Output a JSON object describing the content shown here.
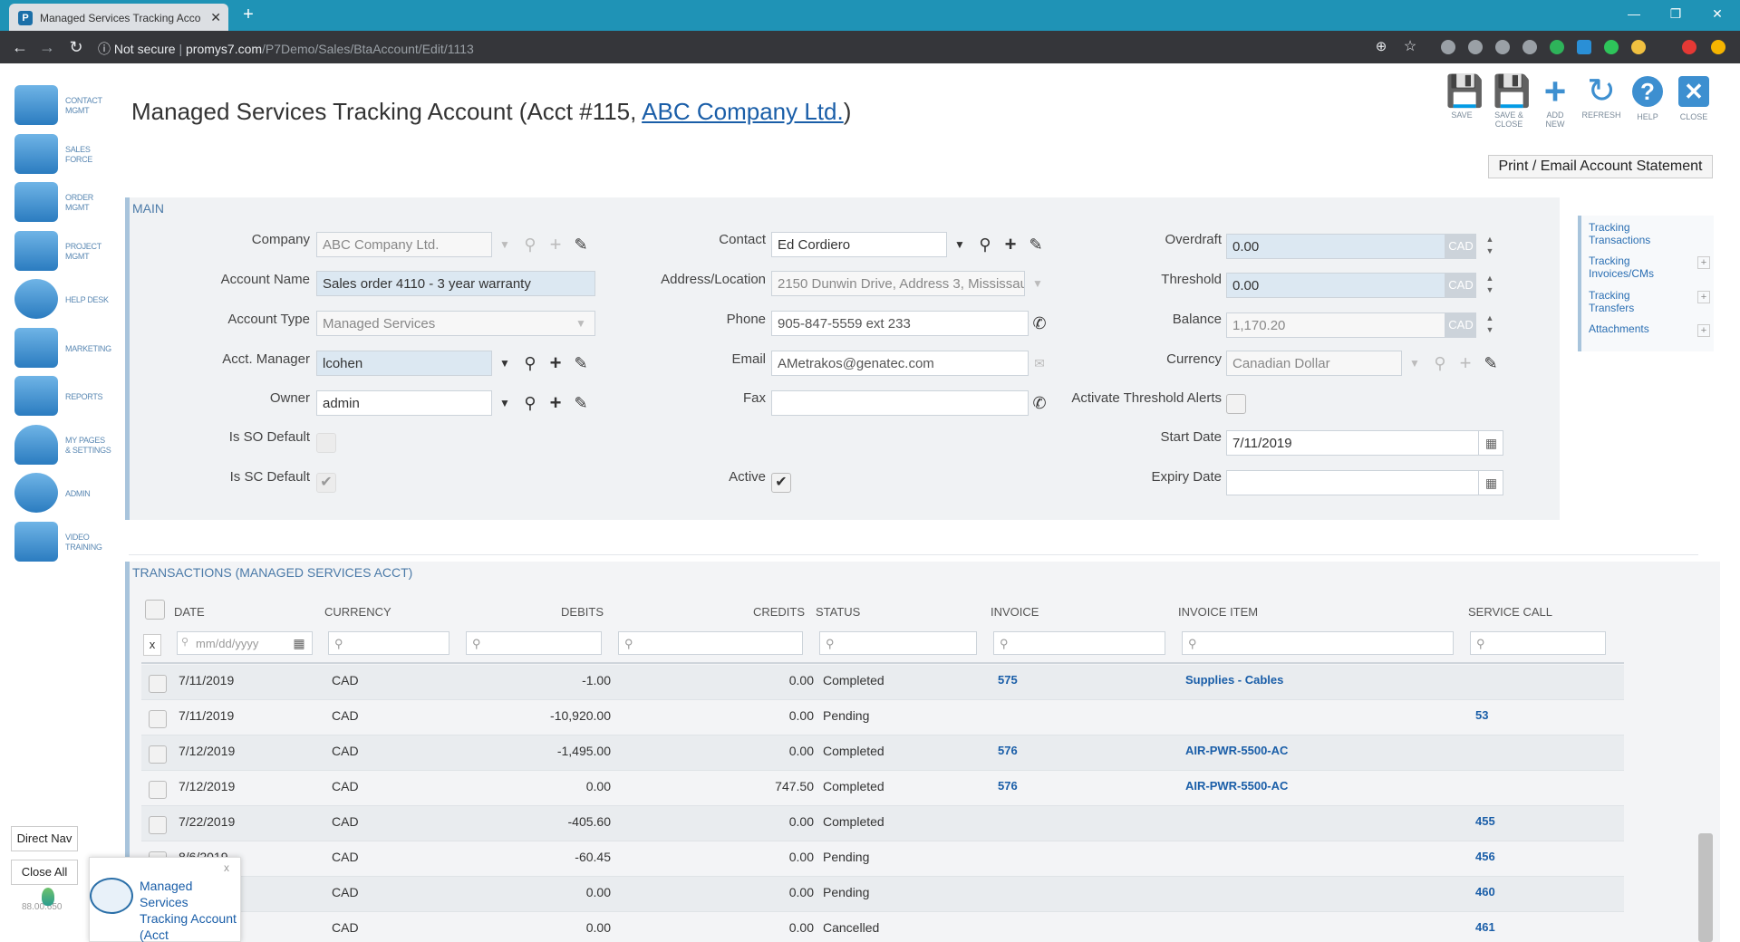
{
  "browser": {
    "tab_title": "Managed Services Tracking Acco",
    "new_tab": "+",
    "url_security": "Not secure",
    "url_host": "promys7.com",
    "url_path": "/P7Demo/Sales/BtaAccount/Edit/1113"
  },
  "leftnav": [
    {
      "line1": "CONTACT",
      "line2": "MGMT"
    },
    {
      "line1": "SALES",
      "line2": "FORCE"
    },
    {
      "line1": "ORDER",
      "line2": "MGMT"
    },
    {
      "line1": "PROJECT",
      "line2": "MGMT"
    },
    {
      "line1": "HELP DESK",
      "line2": ""
    },
    {
      "line1": "MARKETING",
      "line2": ""
    },
    {
      "line1": "REPORTS",
      "line2": ""
    },
    {
      "line1": "MY PAGES",
      "line2": "& SETTINGS"
    },
    {
      "line1": "ADMIN",
      "line2": ""
    },
    {
      "line1": "VIDEO",
      "line2": "TRAINING"
    }
  ],
  "header": {
    "title_prefix": "Managed Services Tracking Account (Acct #115, ",
    "title_link": "ABC Company Ltd.",
    "title_suffix": ")"
  },
  "toolbar": [
    {
      "l1": "SAVE",
      "l2": ""
    },
    {
      "l1": "SAVE &",
      "l2": "CLOSE"
    },
    {
      "l1": "ADD",
      "l2": "NEW"
    },
    {
      "l1": "REFRESH",
      "l2": ""
    },
    {
      "l1": "HELP",
      "l2": ""
    },
    {
      "l1": "CLOSE",
      "l2": ""
    }
  ],
  "print_button": "Print / Email Account Statement",
  "main": {
    "section": "MAIN",
    "company_label": "Company",
    "company": "ABC Company Ltd.",
    "account_name_label": "Account Name",
    "account_name": "Sales order 4110 - 3 year warranty",
    "account_type_label": "Account Type",
    "account_type": "Managed Services",
    "acct_manager_label": "Acct. Manager",
    "acct_manager": "lcohen",
    "owner_label": "Owner",
    "owner": "admin",
    "is_so_default_label": "Is SO Default",
    "is_sc_default_label": "Is SC Default",
    "contact_label": "Contact",
    "contact": "Ed  Cordiero",
    "address_label": "Address/Location",
    "address": "2150 Dunwin Drive, Address 3, Mississau",
    "phone_label": "Phone",
    "phone": "905-847-5559 ext 233",
    "email_label": "Email",
    "email": "AMetrakos@genatec.com",
    "fax_label": "Fax",
    "fax": "",
    "active_label": "Active",
    "overdraft_label": "Overdraft",
    "overdraft": "0.00",
    "threshold_label": "Threshold",
    "threshold": "0.00",
    "balance_label": "Balance",
    "balance": "1,170.20",
    "cad": "CAD",
    "currency_label": "Currency",
    "currency": "Canadian Dollar",
    "threshold_alerts_label": "Activate Threshold Alerts",
    "start_date_label": "Start Date",
    "start_date": "7/11/2019",
    "expiry_date_label": "Expiry Date",
    "expiry_date": ""
  },
  "right_links": [
    {
      "l1": "Tracking",
      "l2": "Transactions"
    },
    {
      "l1": "Tracking",
      "l2": "Invoices/CMs"
    },
    {
      "l1": "Tracking",
      "l2": "Transfers"
    },
    {
      "l1": "Attachments",
      "l2": ""
    }
  ],
  "transactions": {
    "section": "TRANSACTIONS (MANAGED SERVICES ACCT)",
    "headers": [
      "DATE",
      "CURRENCY",
      "DEBITS",
      "CREDITS",
      "STATUS",
      "INVOICE",
      "INVOICE ITEM",
      "SERVICE CALL"
    ],
    "date_placeholder": "mm/dd/yyyy",
    "clear_filter": "x",
    "rows": [
      {
        "date": "7/11/2019",
        "currency": "CAD",
        "debits": "-1.00",
        "credits": "0.00",
        "status": "Completed",
        "invoice": "575",
        "item": "Supplies - Cables",
        "call": ""
      },
      {
        "date": "7/11/2019",
        "currency": "CAD",
        "debits": "-10,920.00",
        "credits": "0.00",
        "status": "Pending",
        "invoice": "",
        "item": "",
        "call": "53"
      },
      {
        "date": "7/12/2019",
        "currency": "CAD",
        "debits": "-1,495.00",
        "credits": "0.00",
        "status": "Completed",
        "invoice": "576",
        "item": "AIR-PWR-5500-AC",
        "call": ""
      },
      {
        "date": "7/12/2019",
        "currency": "CAD",
        "debits": "0.00",
        "credits": "747.50",
        "status": "Completed",
        "invoice": "576",
        "item": "AIR-PWR-5500-AC",
        "call": ""
      },
      {
        "date": "7/22/2019",
        "currency": "CAD",
        "debits": "-405.60",
        "credits": "0.00",
        "status": "Completed",
        "invoice": "",
        "item": "",
        "call": "455"
      },
      {
        "date": "8/6/2019",
        "currency": "CAD",
        "debits": "-60.45",
        "credits": "0.00",
        "status": "Pending",
        "invoice": "",
        "item": "",
        "call": "456"
      },
      {
        "date": "",
        "currency": "CAD",
        "debits": "0.00",
        "credits": "0.00",
        "status": "Pending",
        "invoice": "",
        "item": "",
        "call": "460"
      },
      {
        "date": "",
        "currency": "CAD",
        "debits": "0.00",
        "credits": "0.00",
        "status": "Cancelled",
        "invoice": "",
        "item": "",
        "call": "461"
      }
    ]
  },
  "bottom": {
    "direct_nav": "Direct Nav",
    "close_all": "Close All",
    "version": "88.00.650",
    "notif_text": "Managed Services Tracking Account (Acct",
    "notif_close": "x"
  }
}
